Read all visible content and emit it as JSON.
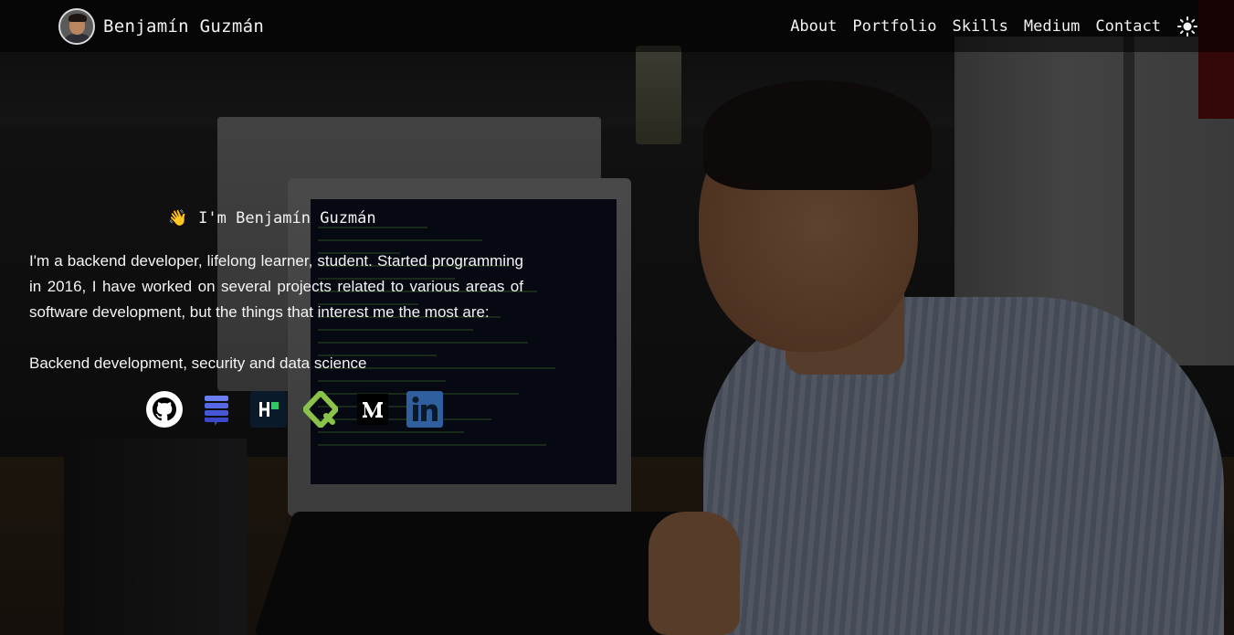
{
  "brand": {
    "name": "Benjamín Guzmán",
    "avatar_icon": "profile-photo-avatar"
  },
  "nav": {
    "items": [
      {
        "label": "About"
      },
      {
        "label": "Portfolio"
      },
      {
        "label": "Skills"
      },
      {
        "label": "Medium"
      },
      {
        "label": "Contact"
      }
    ],
    "theme_toggle_icon": "sun-icon"
  },
  "hero": {
    "wave_emoji": "👋",
    "greeting": "I'm Benjamín Guzmán",
    "bio": "I'm a backend developer, lifelong learner, student. Started programming in 2016, I have worked on several projects related to various areas of software development, but the things that interest me the most are:",
    "focus": "Backend development, security and data science",
    "socials": [
      {
        "name": "github",
        "icon": "github-icon"
      },
      {
        "name": "stack-overflow",
        "icon": "stack-icon"
      },
      {
        "name": "hackerrank",
        "icon": "hackerrank-icon"
      },
      {
        "name": "eligible",
        "icon": "green-diamond-icon"
      },
      {
        "name": "medium",
        "icon": "medium-icon"
      },
      {
        "name": "linkedin",
        "icon": "linkedin-icon"
      }
    ]
  },
  "colors": {
    "text": "#f2f2f2",
    "navbar_bg": "rgba(0,0,0,0.55)",
    "linkedin": "#2f5f9e",
    "green_icon": "#8bc34a"
  }
}
